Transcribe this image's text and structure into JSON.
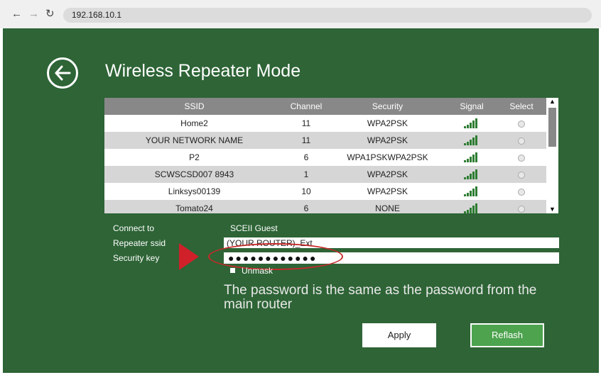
{
  "browser": {
    "back_icon": "arrow-left-icon",
    "forward_icon": "arrow-right-icon",
    "reload_icon": "reload-icon",
    "url": "192.168.10.1"
  },
  "page": {
    "title": "Wireless Repeater Mode",
    "back_icon": "circle-arrow-left-icon"
  },
  "table": {
    "headers": [
      "SSID",
      "Channel",
      "Security",
      "Signal",
      "Select"
    ],
    "rows": [
      {
        "ssid": "Home2",
        "channel": "11",
        "security": "WPA2PSK"
      },
      {
        "ssid": "YOUR NETWORK NAME",
        "channel": "11",
        "security": "WPA2PSK"
      },
      {
        "ssid": "P2",
        "channel": "6",
        "security": "WPA1PSKWPA2PSK"
      },
      {
        "ssid": "SCWSCSD007 8943",
        "channel": "1",
        "security": "WPA2PSK"
      },
      {
        "ssid": "Linksys00139",
        "channel": "10",
        "security": "WPA2PSK"
      },
      {
        "ssid": "Tomato24",
        "channel": "6",
        "security": "NONE"
      }
    ]
  },
  "form": {
    "connect_to_label": "Connect to",
    "connect_to_value": "SCEII Guest",
    "repeater_ssid_label": "Repeater ssid",
    "repeater_ssid_value": "(YOUR ROUTER)_Ext",
    "security_key_label": "Security key",
    "security_key_value": "●●●●●●●●●●●●",
    "unmask_label": "Unmask",
    "note": "The password is the same as the password from the main router",
    "apply_label": "Apply",
    "reflash_label": "Reflash"
  },
  "colors": {
    "background": "#2e6436",
    "header": "#888888",
    "reflash": "#4da34e",
    "highlight": "#c52a2a"
  }
}
